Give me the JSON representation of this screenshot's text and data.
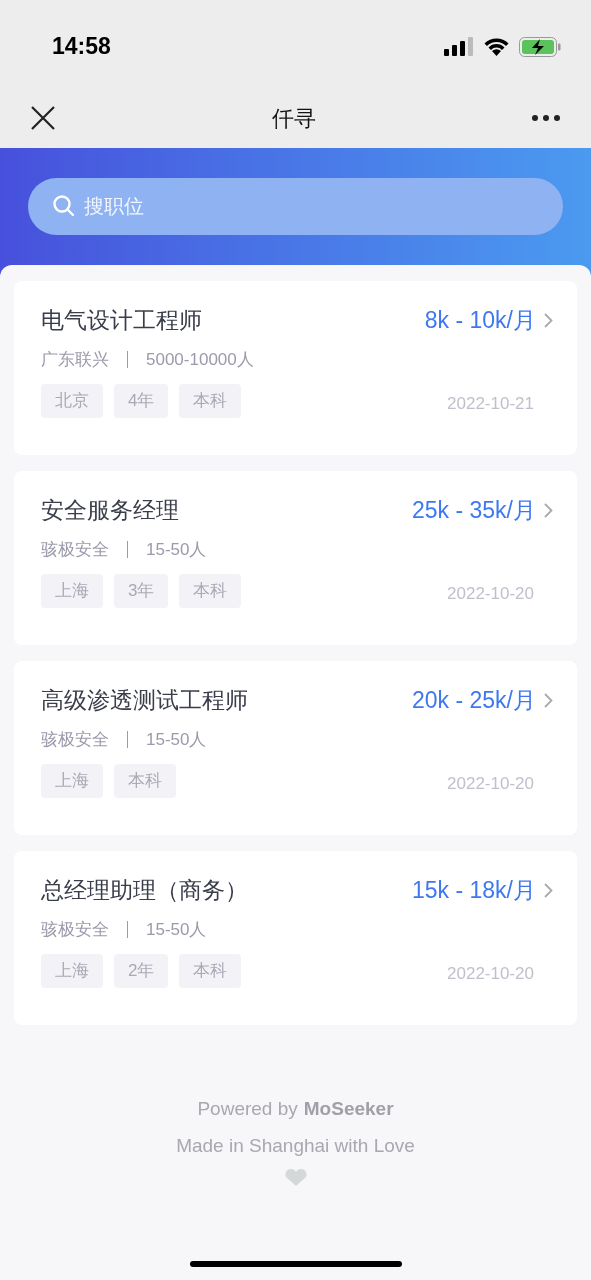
{
  "status_bar": {
    "time": "14:58"
  },
  "nav": {
    "title": "仟寻"
  },
  "search": {
    "placeholder": "搜职位"
  },
  "jobs": [
    {
      "title": "电气设计工程师",
      "salary": "8k - 10k/月",
      "company": "广东联兴",
      "size": "5000-10000人",
      "tags": [
        "北京",
        "4年",
        "本科"
      ],
      "date": "2022-10-21"
    },
    {
      "title": "安全服务经理",
      "salary": "25k - 35k/月",
      "company": "骇极安全",
      "size": "15-50人",
      "tags": [
        "上海",
        "3年",
        "本科"
      ],
      "date": "2022-10-20"
    },
    {
      "title": "高级渗透测试工程师",
      "salary": "20k - 25k/月",
      "company": "骇极安全",
      "size": "15-50人",
      "tags": [
        "上海",
        "本科"
      ],
      "date": "2022-10-20"
    },
    {
      "title": "总经理助理（商务）",
      "salary": "15k - 18k/月",
      "company": "骇极安全",
      "size": "15-50人",
      "tags": [
        "上海",
        "2年",
        "本科"
      ],
      "date": "2022-10-20"
    }
  ],
  "footer": {
    "powered": "Powered by",
    "brand": "MoSeeker",
    "tagline": "Made in Shanghai with Love"
  }
}
